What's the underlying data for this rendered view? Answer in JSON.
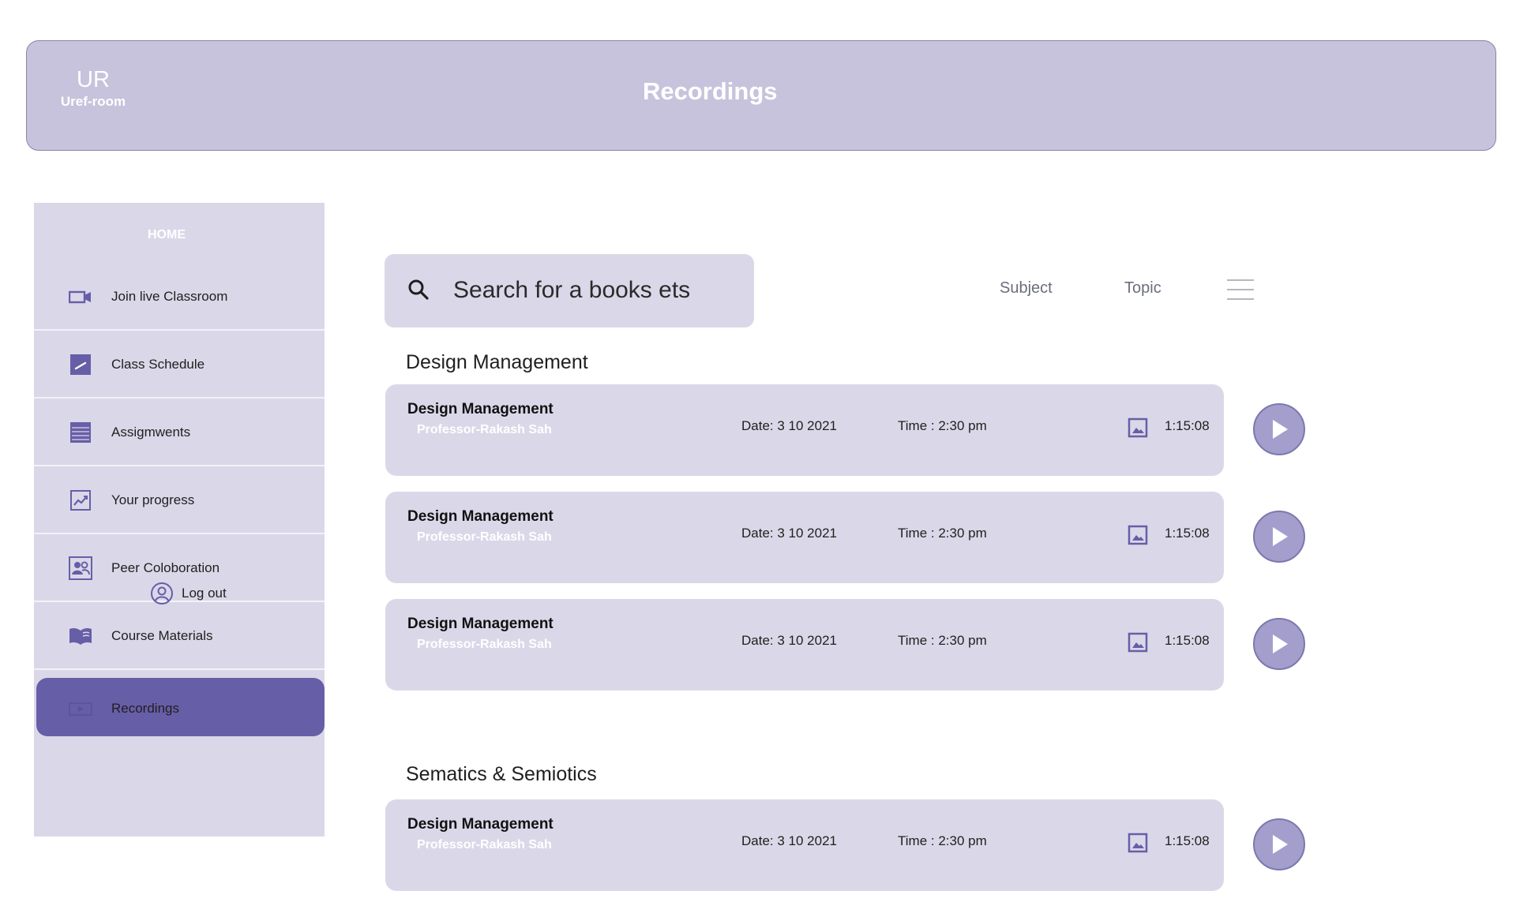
{
  "app": {
    "initials": "UR",
    "name": "Uref-room"
  },
  "header": {
    "title": "Recordings"
  },
  "sidebar": {
    "home_label": "HOME",
    "items": [
      {
        "label": "Join live Classroom",
        "icon": "video-camera-icon"
      },
      {
        "label": "Class Schedule",
        "icon": "calendar-edit-icon"
      },
      {
        "label": "Assigmwents",
        "icon": "list-icon"
      },
      {
        "label": "Your progress",
        "icon": "trending-chart-icon"
      },
      {
        "label": "Peer Coloboration",
        "icon": "people-icon"
      },
      {
        "label": "Course Materials",
        "icon": "book-icon"
      },
      {
        "label": "Recordings",
        "icon": "recording-icon",
        "active": true
      }
    ],
    "logout_label": "Log out"
  },
  "search": {
    "placeholder": "Search for a books ets"
  },
  "filters": {
    "subject": "Subject",
    "topic": "Topic"
  },
  "sections": [
    {
      "title": "Design Management",
      "recordings": [
        {
          "title": "Design Management",
          "professor": "Professor-Rakash Sah",
          "date": "Date: 3 10 2021",
          "time": "Time : 2:30 pm",
          "duration": "1:15:08"
        },
        {
          "title": "Design Management",
          "professor": "Professor-Rakash Sah",
          "date": "Date: 3 10 2021",
          "time": "Time : 2:30 pm",
          "duration": "1:15:08"
        },
        {
          "title": "Design Management",
          "professor": "Professor-Rakash Sah",
          "date": "Date: 3 10 2021",
          "time": "Time : 2:30 pm",
          "duration": "1:15:08"
        }
      ]
    },
    {
      "title": "Sematics & Semiotics",
      "recordings": [
        {
          "title": "Design Management",
          "professor": "Professor-Rakash Sah",
          "date": "Date: 3 10 2021",
          "time": "Time : 2:30 pm",
          "duration": "1:15:08"
        }
      ]
    }
  ],
  "colors": {
    "accent": "#675ea8",
    "header_bg": "#c7c3dc",
    "card_bg": "#dad8e8",
    "play_bg": "#a39ecc"
  }
}
